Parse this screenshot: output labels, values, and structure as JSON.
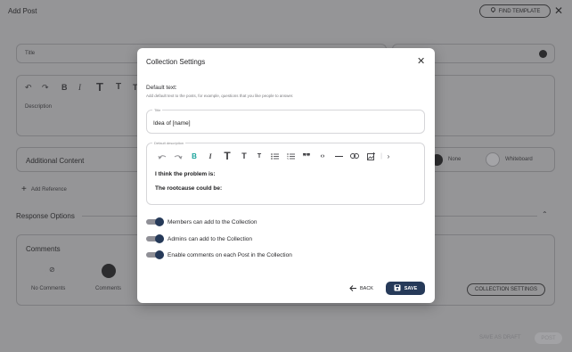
{
  "page": {
    "title": "Add Post",
    "find_template_label": "FIND TEMPLATE",
    "title_placeholder": "Title",
    "description_placeholder": "Description",
    "additional_content_label": "Additional Content",
    "add_reference_label": "Add Reference",
    "response_options_label": "Response Options",
    "comments_label": "Comments",
    "no_comments_label": "No Comments",
    "comments_option_label": "Comments",
    "none_label": "None",
    "whiteboard_label": "Whiteboard",
    "collection_settings_label": "COLLECTION SETTINGS",
    "save_as_draft_label": "SAVE AS DRAFT",
    "post_label": "POST"
  },
  "modal": {
    "title": "Collection Settings",
    "default_text_label": "Default text:",
    "default_text_help": "Add default text to the posts, for example, questions that you like people to answer.",
    "title_legend": "Title",
    "title_value": "Idea of [name]",
    "description_legend": "Default description",
    "description_lines": [
      "I think the problem is:",
      "The rootcause could be:"
    ],
    "toggles": [
      {
        "label": "Members can add to the Collection",
        "on": true
      },
      {
        "label": "Admins can add to the Collection",
        "on": true
      },
      {
        "label": "Enable comments on each Post in the Collection",
        "on": true
      }
    ],
    "back_label": "BACK",
    "save_label": "SAVE",
    "toolbar_icons": [
      "undo-icon",
      "redo-icon",
      "bold-icon",
      "italic-icon",
      "heading-1-icon",
      "heading-2-icon",
      "heading-3-icon",
      "bullet-list-icon",
      "numbered-list-icon",
      "quote-icon",
      "code-icon",
      "horizontal-rule-icon",
      "link-icon",
      "image-icon",
      "more-icon"
    ]
  },
  "colors": {
    "primary": "#263a59",
    "accent_bold": "#1aa39b",
    "overlay": "#959597"
  }
}
